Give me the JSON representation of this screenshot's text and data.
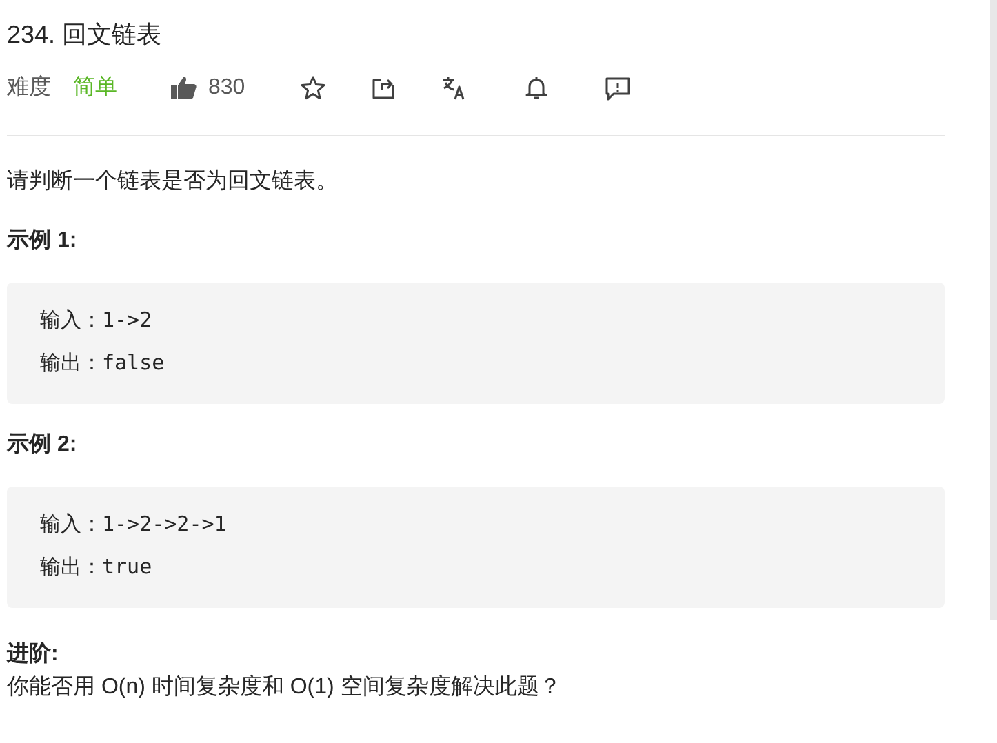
{
  "title": "234. 回文链表",
  "difficulty": {
    "label": "难度",
    "value": "简单",
    "kind": "easy"
  },
  "likes": "830",
  "description": "请判断一个链表是否为回文链表。",
  "examples": [
    {
      "heading": "示例 1:",
      "lines": [
        "输入：1->2",
        "输出：false"
      ]
    },
    {
      "heading": "示例 2:",
      "lines": [
        "输入：1->2->2->1",
        "输出：true"
      ]
    }
  ],
  "followup": {
    "heading": "进阶:",
    "text": "你能否用 O(n) 时间复杂度和 O(1) 空间复杂度解决此题？"
  }
}
